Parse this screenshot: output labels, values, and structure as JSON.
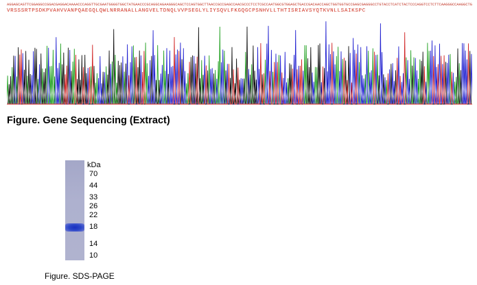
{
  "sequencing": {
    "nucleotide_track": "AGGAGCAGTTCGGAGGCCGGACGAGGACAAAACCCAGGTTGCGAATGGGGTGGCTATGAACCCGCAGGCAGAAGGGCAGCTCCAGTGGCTTAACCGCCGAGCCAACGCCCTCCTCGCCAATGGCGTGGAGCTGACCGACAACCAGCTGGTGGTGCCGAGCGAGGGCCTGTACCTCATCTACTCCCAGGTCCTCTTCAAGGGCCAAGGCTGCCCCTCCAACCATGTGCTCCTCACCCACACCATCAGCCGCATCGCCGTCTCCTACCAGACCAAGGTCAACCTCCTCTCTGCCATCAAGAGCCCCTGC",
    "amino_acid_track": "VRSSSRTPSDKPVAHVVANPQAEGQLQWLNRRANALLANGVELTDNQLVVPSEGLYLIYSQVLFKGQGCPSNHVLLTHTISRIAVSYQTKVNLLSAIKSPC",
    "caption": "Figure. Gene Sequencing (Extract)"
  },
  "sds_page": {
    "unit_label": "kDa",
    "markers": [
      "70",
      "44",
      "33",
      "26",
      "22",
      "18",
      "14",
      "10"
    ],
    "band_kda": "18",
    "caption": "Figure. SDS-PAGE"
  },
  "colors": {
    "base_a": "#20a020",
    "base_c": "#2020d0",
    "base_g": "#101010",
    "base_t": "#d02020",
    "band": "#1a30c0",
    "gel": "#aeb1cf"
  }
}
